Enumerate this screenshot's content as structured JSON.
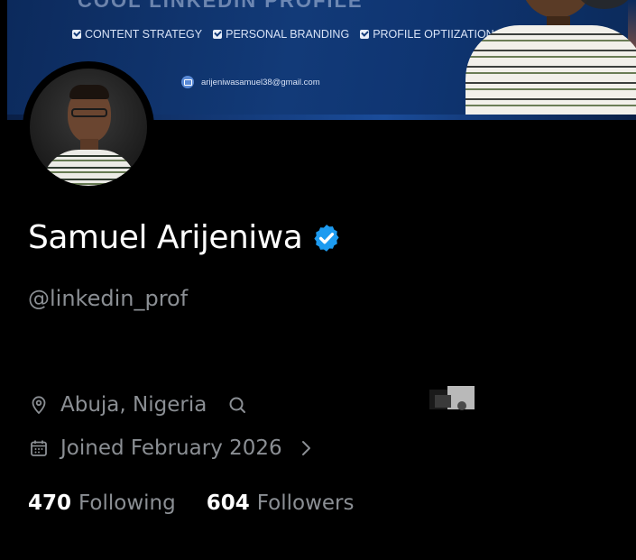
{
  "banner": {
    "headline_partial": "COOL LINKEDIN PROFILE",
    "tags": [
      "CONTENT STRATEGY",
      "PERSONAL BRANDING",
      "PROFILE OPTIIZATION"
    ],
    "email": "arijeniwasamuel38@gmail.com"
  },
  "profile": {
    "name": "Samuel Arijeniwa",
    "verified": true,
    "handle": "@linkedin_prof",
    "location": "Abuja, Nigeria",
    "joined": "Joined February 2026",
    "following_count": "470",
    "following_label": "Following",
    "followers_count": "604",
    "followers_label": "Followers"
  },
  "colors": {
    "background": "#000000",
    "banner_blue": "#123a78",
    "verified_blue": "#1d9bf0",
    "muted_text": "#8b8f94",
    "primary_text": "#ffffff"
  },
  "icons": {
    "verified": "verified-badge-icon",
    "location": "location-pin-icon",
    "website": "link-icon",
    "joined": "calendar-icon",
    "joined_more": "chevron-right-icon",
    "email": "email-icon"
  }
}
